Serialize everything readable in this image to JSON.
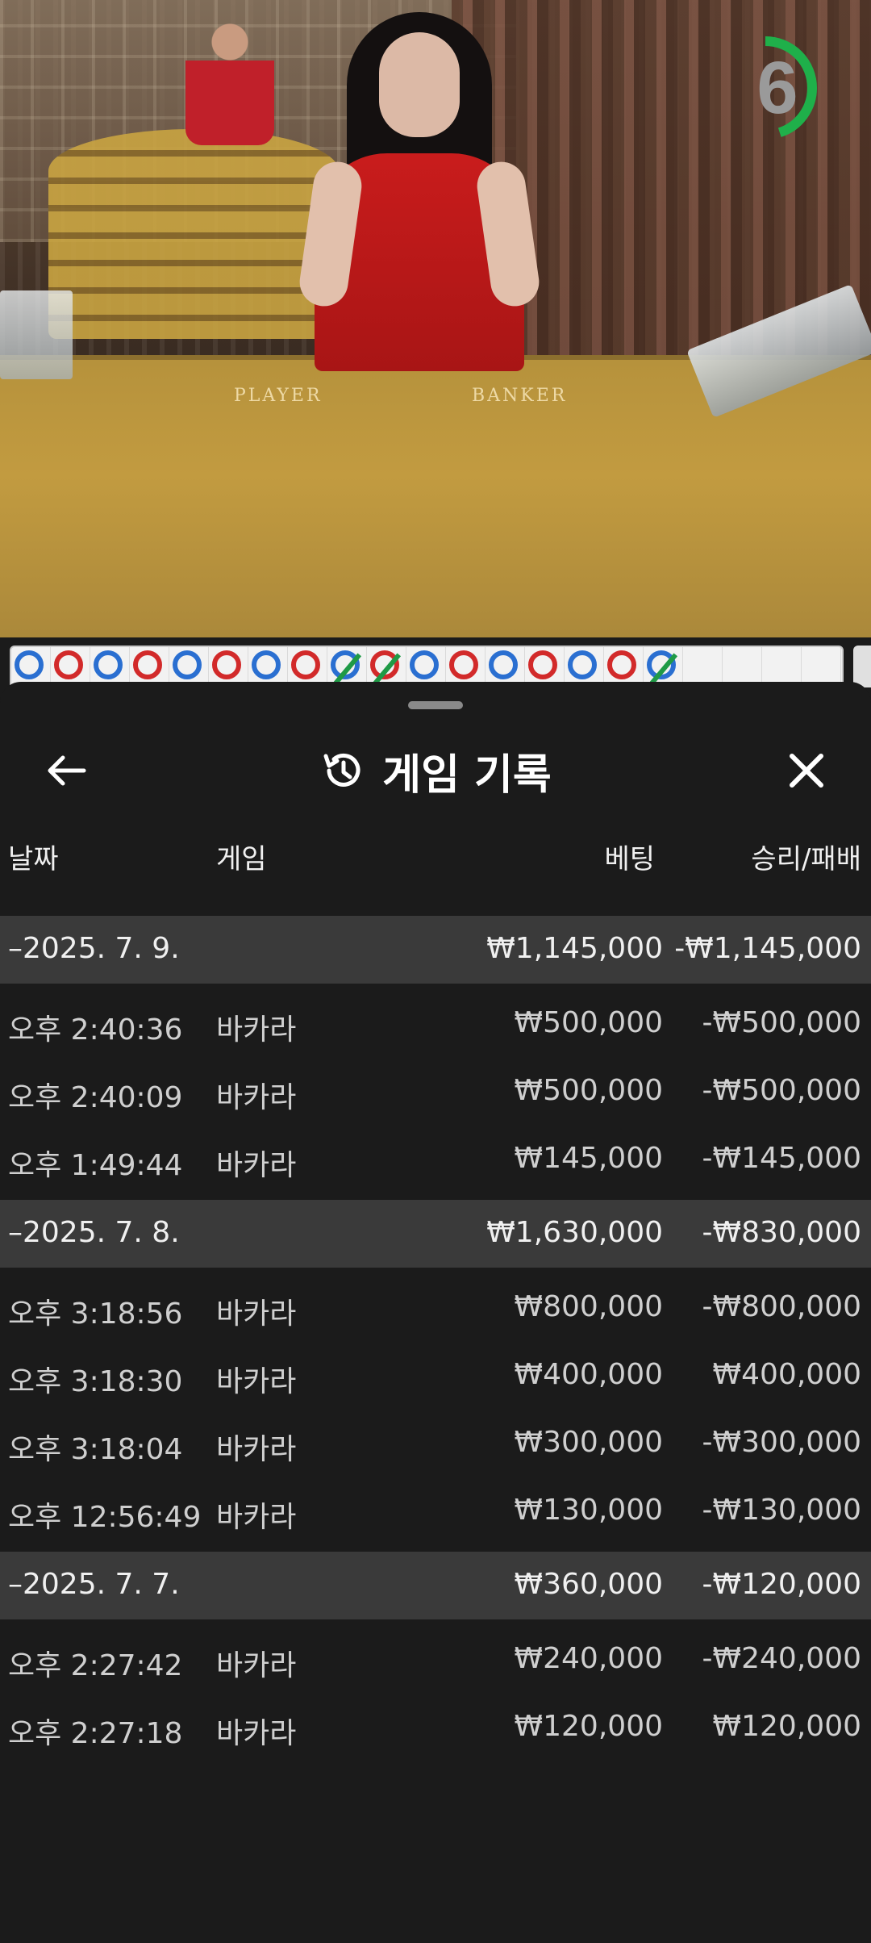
{
  "video": {
    "table_labels": [
      "PLAYER",
      "BANKER"
    ],
    "countdown": "6",
    "countdown_fraction": 0.45,
    "colors": {
      "timer_ring": "#1fb04a",
      "player": "#2a6fd1",
      "banker": "#d22a2a",
      "tie": "#1f9a46"
    }
  },
  "road": {
    "beads": [
      "P",
      "B",
      "P",
      "B",
      "P",
      "B",
      "P",
      "B",
      "P-T",
      "B-T",
      "P",
      "B",
      "P",
      "B",
      "P",
      "B",
      "P-T"
    ]
  },
  "panel": {
    "title": "게임 기록",
    "icons": {
      "back": "back-arrow-icon",
      "history": "history-icon",
      "close": "close-icon"
    },
    "columns": {
      "date": "날짜",
      "game": "게임",
      "bet": "베팅",
      "result": "승리/패배"
    },
    "groups": [
      {
        "date": "–2025. 7. 9.",
        "bet": "₩1,145,000",
        "result": "-₩1,145,000",
        "rows": [
          {
            "time": "오후 2:40:36",
            "game": "바카라",
            "bet": "₩500,000",
            "result": "-₩500,000"
          },
          {
            "time": "오후 2:40:09",
            "game": "바카라",
            "bet": "₩500,000",
            "result": "-₩500,000"
          },
          {
            "time": "오후 1:49:44",
            "game": "바카라",
            "bet": "₩145,000",
            "result": "-₩145,000"
          }
        ]
      },
      {
        "date": "–2025. 7. 8.",
        "bet": "₩1,630,000",
        "result": "-₩830,000",
        "rows": [
          {
            "time": "오후 3:18:56",
            "game": "바카라",
            "bet": "₩800,000",
            "result": "-₩800,000"
          },
          {
            "time": "오후 3:18:30",
            "game": "바카라",
            "bet": "₩400,000",
            "result": "₩400,000"
          },
          {
            "time": "오후 3:18:04",
            "game": "바카라",
            "bet": "₩300,000",
            "result": "-₩300,000"
          },
          {
            "time": "오후 12:56:49",
            "game": "바카라",
            "bet": "₩130,000",
            "result": "-₩130,000"
          }
        ]
      },
      {
        "date": "–2025. 7. 7.",
        "bet": "₩360,000",
        "result": "-₩120,000",
        "rows": [
          {
            "time": "오후 2:27:42",
            "game": "바카라",
            "bet": "₩240,000",
            "result": "-₩240,000"
          },
          {
            "time": "오후 2:27:18",
            "game": "바카라",
            "bet": "₩120,000",
            "result": "₩120,000"
          }
        ]
      }
    ]
  }
}
